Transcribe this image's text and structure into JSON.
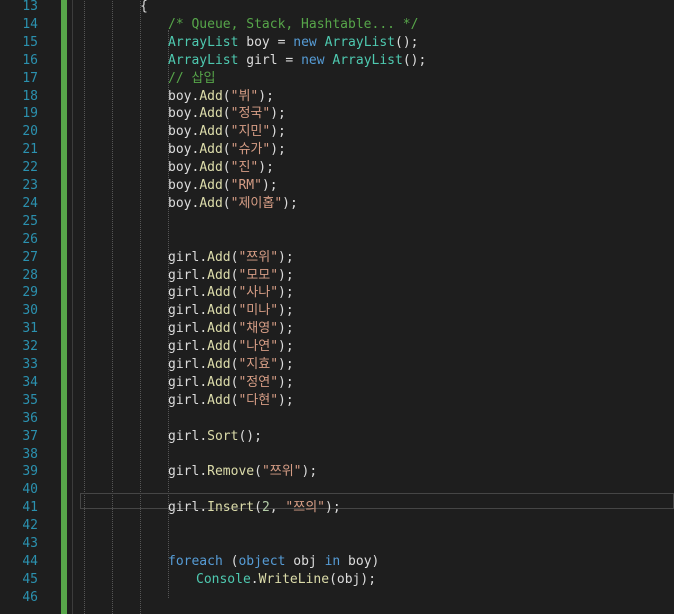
{
  "editor": {
    "line_numbers": [
      "13",
      "14",
      "15",
      "16",
      "17",
      "18",
      "19",
      "20",
      "21",
      "22",
      "23",
      "24",
      "25",
      "26",
      "27",
      "28",
      "29",
      "30",
      "31",
      "32",
      "33",
      "34",
      "35",
      "36",
      "37",
      "38",
      "39",
      "40",
      "41",
      "42",
      "43",
      "44",
      "45",
      "46"
    ],
    "lines": [
      {
        "n": "13",
        "text": "{"
      },
      {
        "n": "14",
        "text": "/* Queue, Stack, Hashtable... */"
      },
      {
        "n": "15",
        "text": "ArrayList boy = new ArrayList();"
      },
      {
        "n": "16",
        "text": "ArrayList girl = new ArrayList();"
      },
      {
        "n": "17",
        "text": "// 삽입"
      },
      {
        "n": "18",
        "text": "boy.Add(\"뷔\");"
      },
      {
        "n": "19",
        "text": "boy.Add(\"정국\");"
      },
      {
        "n": "20",
        "text": "boy.Add(\"지민\");"
      },
      {
        "n": "21",
        "text": "boy.Add(\"슈가\");"
      },
      {
        "n": "22",
        "text": "boy.Add(\"진\");"
      },
      {
        "n": "23",
        "text": "boy.Add(\"RM\");"
      },
      {
        "n": "24",
        "text": "boy.Add(\"제이홉\");"
      },
      {
        "n": "25",
        "text": ""
      },
      {
        "n": "26",
        "text": ""
      },
      {
        "n": "27",
        "text": "girl.Add(\"쯔위\");"
      },
      {
        "n": "28",
        "text": "girl.Add(\"모모\");"
      },
      {
        "n": "29",
        "text": "girl.Add(\"사나\");"
      },
      {
        "n": "30",
        "text": "girl.Add(\"미나\");"
      },
      {
        "n": "31",
        "text": "girl.Add(\"채영\");"
      },
      {
        "n": "32",
        "text": "girl.Add(\"나연\");"
      },
      {
        "n": "33",
        "text": "girl.Add(\"지효\");"
      },
      {
        "n": "34",
        "text": "girl.Add(\"정연\");"
      },
      {
        "n": "35",
        "text": "girl.Add(\"다현\");"
      },
      {
        "n": "36",
        "text": ""
      },
      {
        "n": "37",
        "text": "girl.Sort();"
      },
      {
        "n": "38",
        "text": ""
      },
      {
        "n": "39",
        "text": "girl.Remove(\"쯔위\");"
      },
      {
        "n": "40",
        "text": ""
      },
      {
        "n": "41",
        "text": "girl.Insert(2, \"쯔의\");"
      },
      {
        "n": "42",
        "text": ""
      },
      {
        "n": "43",
        "text": ""
      },
      {
        "n": "44",
        "text": "foreach (object obj in boy)"
      },
      {
        "n": "45",
        "text": "Console.WriteLine(obj);"
      },
      {
        "n": "46",
        "text": ""
      }
    ]
  },
  "colors": {
    "background": "#1e1e1e",
    "line_number": "#2b91af",
    "keyword": "#569cd6",
    "type": "#4ec9b0",
    "string": "#d69d85",
    "comment": "#57a64a",
    "change_bar": "#57a64a"
  }
}
